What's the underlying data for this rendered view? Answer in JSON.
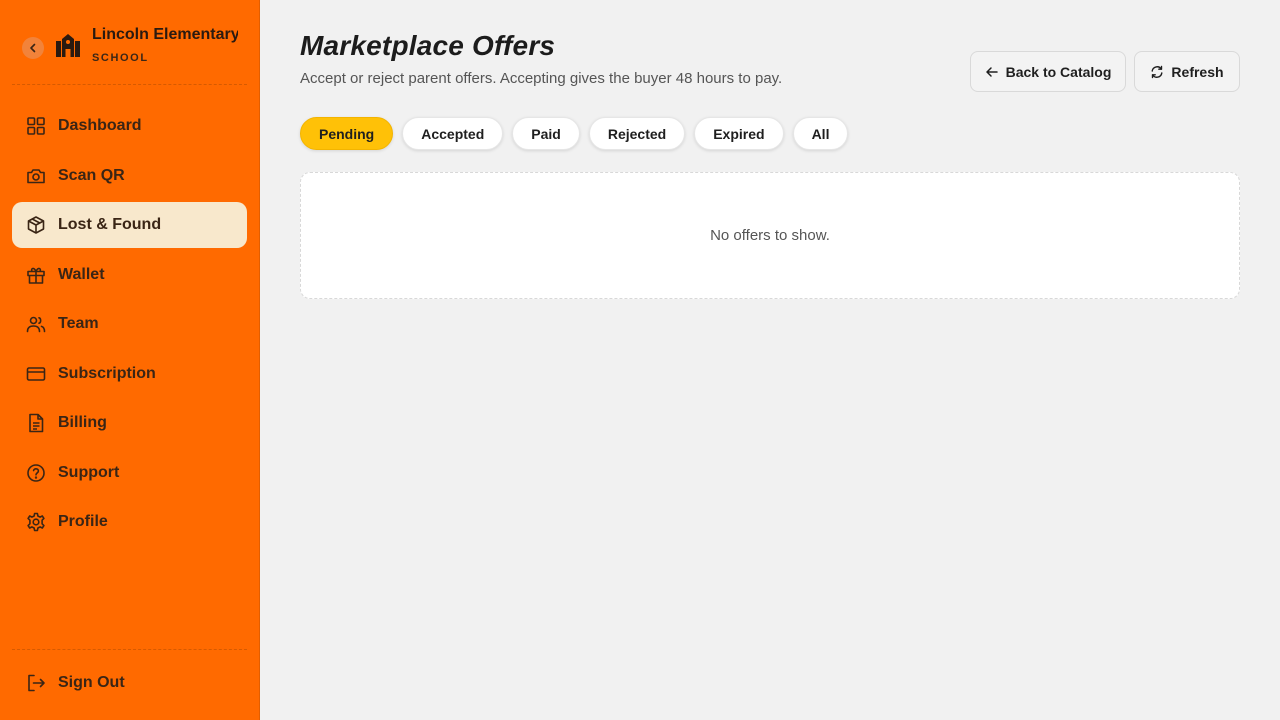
{
  "brand": {
    "name": "Lincoln Elementary",
    "type_label": "SCHOOL"
  },
  "sidebar": {
    "items": [
      {
        "label": "Dashboard",
        "icon": "grid-icon",
        "active": false
      },
      {
        "label": "Scan QR",
        "icon": "camera-icon",
        "active": false
      },
      {
        "label": "Lost & Found",
        "icon": "box-icon",
        "active": true
      },
      {
        "label": "Wallet",
        "icon": "gift-icon",
        "active": false
      },
      {
        "label": "Team",
        "icon": "users-icon",
        "active": false
      },
      {
        "label": "Subscription",
        "icon": "credit-card-icon",
        "active": false
      },
      {
        "label": "Billing",
        "icon": "document-icon",
        "active": false
      },
      {
        "label": "Support",
        "icon": "help-circle-icon",
        "active": false
      },
      {
        "label": "Profile",
        "icon": "gear-icon",
        "active": false
      }
    ],
    "sign_out": "Sign Out"
  },
  "header": {
    "title": "Marketplace Offers",
    "subtitle": "Accept or reject parent offers. Accepting gives the buyer 48 hours to pay.",
    "back_label": "Back to Catalog",
    "refresh_label": "Refresh"
  },
  "tabs": [
    {
      "label": "Pending",
      "active": true
    },
    {
      "label": "Accepted",
      "active": false
    },
    {
      "label": "Paid",
      "active": false
    },
    {
      "label": "Rejected",
      "active": false
    },
    {
      "label": "Expired",
      "active": false
    },
    {
      "label": "All",
      "active": false
    }
  ],
  "empty_state": {
    "message": "No offers to show."
  },
  "colors": {
    "sidebar_bg": "#ff6a00",
    "active_nav_bg": "#f8e8cc",
    "active_tab_bg": "#ffc107",
    "page_bg": "#f1f1f1"
  }
}
